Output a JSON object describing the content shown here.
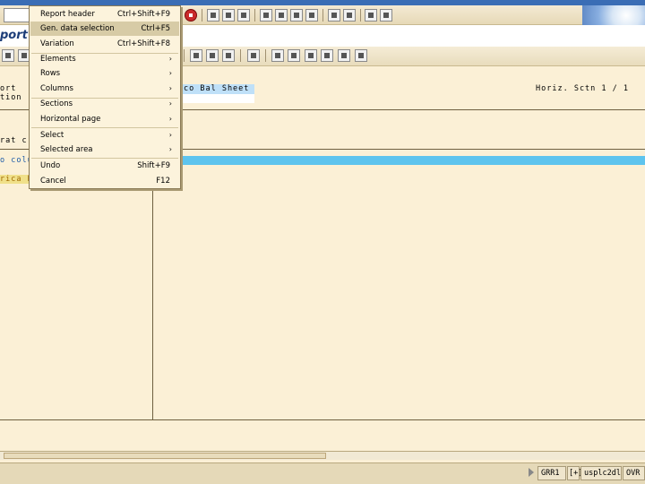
{
  "title": "port",
  "header": {
    "left_line1": "ort",
    "left_line2": "tion",
    "selected_value": "co Bal Sheet",
    "right_text": "Horiz. Sctn    1 / 1"
  },
  "gen_area_text": "rat cr",
  "columns": {
    "left_label": "o colu",
    "left_row2": "rica B"
  },
  "menu": {
    "items": [
      {
        "label": "Report header",
        "shortcut": "Ctrl+Shift+F9",
        "submenu": false
      },
      {
        "label": "Gen. data selection",
        "shortcut": "Ctrl+F5",
        "submenu": false
      },
      {
        "label": "Variation",
        "shortcut": "Ctrl+Shift+F8",
        "submenu": false
      },
      {
        "label": "Elements",
        "shortcut": "",
        "submenu": true
      },
      {
        "label": "Rows",
        "shortcut": "",
        "submenu": true
      },
      {
        "label": "Columns",
        "shortcut": "",
        "submenu": true
      },
      {
        "label": "Sections",
        "shortcut": "",
        "submenu": true
      },
      {
        "label": "Horizontal page",
        "shortcut": "",
        "submenu": true
      },
      {
        "label": "Select",
        "shortcut": "",
        "submenu": true
      },
      {
        "label": "Selected area",
        "shortcut": "",
        "submenu": true
      },
      {
        "label": "Undo",
        "shortcut": "Shift+F9",
        "submenu": false
      },
      {
        "label": "Cancel",
        "shortcut": "F12",
        "submenu": false
      }
    ],
    "submenu_arrow": "›"
  },
  "status": {
    "system": "GRR1",
    "client_icon": "[+]",
    "server": "usplc2dl",
    "mode": "OVR"
  },
  "colors": {
    "highlight_blue": "#5ec4ee",
    "selection_blue": "#bfe0f8",
    "background": "#fbf0d6"
  }
}
